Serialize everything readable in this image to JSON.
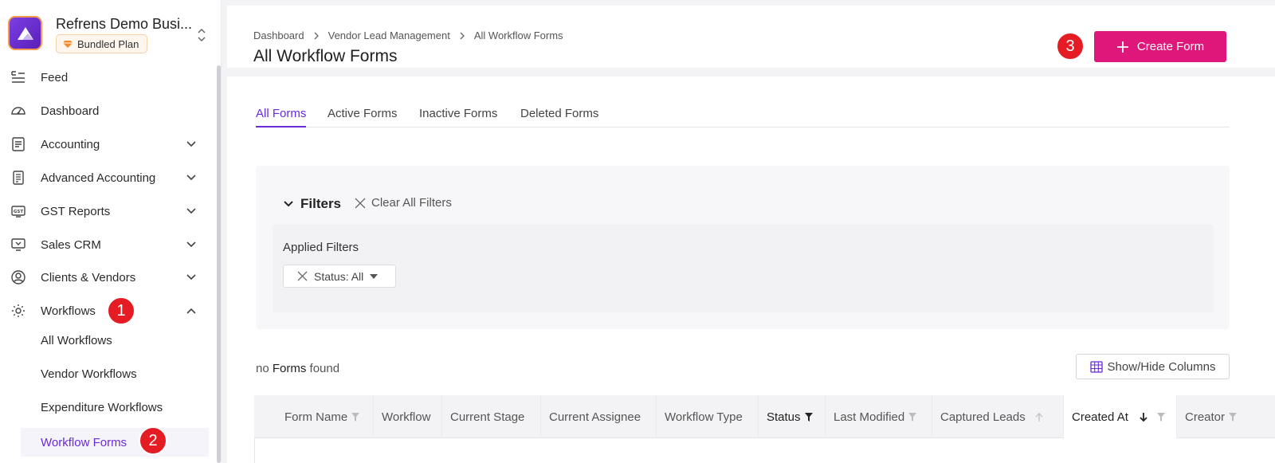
{
  "org": {
    "name": "Refrens Demo Busi...",
    "plan": "Bundled Plan"
  },
  "nav": [
    {
      "label": "Feed",
      "icon": "feed-icon",
      "chevron": ""
    },
    {
      "label": "Dashboard",
      "icon": "dashboard-icon",
      "chevron": ""
    },
    {
      "label": "Accounting",
      "icon": "accounting-icon",
      "chevron": "down"
    },
    {
      "label": "Advanced Accounting",
      "icon": "advanced-accounting-icon",
      "chevron": "down"
    },
    {
      "label": "GST Reports",
      "icon": "gst-icon",
      "chevron": "down"
    },
    {
      "label": "Sales CRM",
      "icon": "sales-crm-icon",
      "chevron": "down"
    },
    {
      "label": "Clients & Vendors",
      "icon": "clients-vendors-icon",
      "chevron": "down"
    },
    {
      "label": "Workflows",
      "icon": "workflows-icon",
      "chevron": "up"
    }
  ],
  "subnav": [
    {
      "label": "All Workflows",
      "active": false
    },
    {
      "label": "Vendor Workflows",
      "active": false
    },
    {
      "label": "Expenditure Workflows",
      "active": false
    },
    {
      "label": "Workflow Forms",
      "active": true
    }
  ],
  "badges": [
    "1",
    "2",
    "3"
  ],
  "breadcrumb": [
    "Dashboard",
    "Vendor Lead Management",
    "All Workflow Forms"
  ],
  "page_title": "All Workflow Forms",
  "create_button": "Create Form",
  "tabs": [
    {
      "label": "All Forms",
      "active": true
    },
    {
      "label": "Active Forms",
      "active": false
    },
    {
      "label": "Inactive Forms",
      "active": false
    },
    {
      "label": "Deleted Forms",
      "active": false
    }
  ],
  "filters": {
    "title": "Filters",
    "clear_all": "Clear All Filters",
    "applied_title": "Applied Filters",
    "chips": [
      "Status: All"
    ]
  },
  "results": {
    "prefix": "no",
    "entity": "Forms",
    "suffix": "found"
  },
  "show_hide_columns": "Show/Hide Columns",
  "columns": [
    {
      "label": "Form Name",
      "icon": "filter"
    },
    {
      "label": "Workflow",
      "icon": ""
    },
    {
      "label": "Current Stage",
      "icon": ""
    },
    {
      "label": "Current Assignee",
      "icon": ""
    },
    {
      "label": "Workflow Type",
      "icon": ""
    },
    {
      "label": "Status",
      "icon": "filter-active"
    },
    {
      "label": "Last Modified",
      "icon": "filter"
    },
    {
      "label": "Captured Leads",
      "icon": "sort-up"
    },
    {
      "label": "Created At",
      "icon": "sort-down"
    },
    {
      "label": "Creator",
      "icon": "filter"
    }
  ],
  "colors": {
    "accent": "#6a2bd9",
    "primary_button": "#e0177b",
    "badge": "#e51c23"
  }
}
